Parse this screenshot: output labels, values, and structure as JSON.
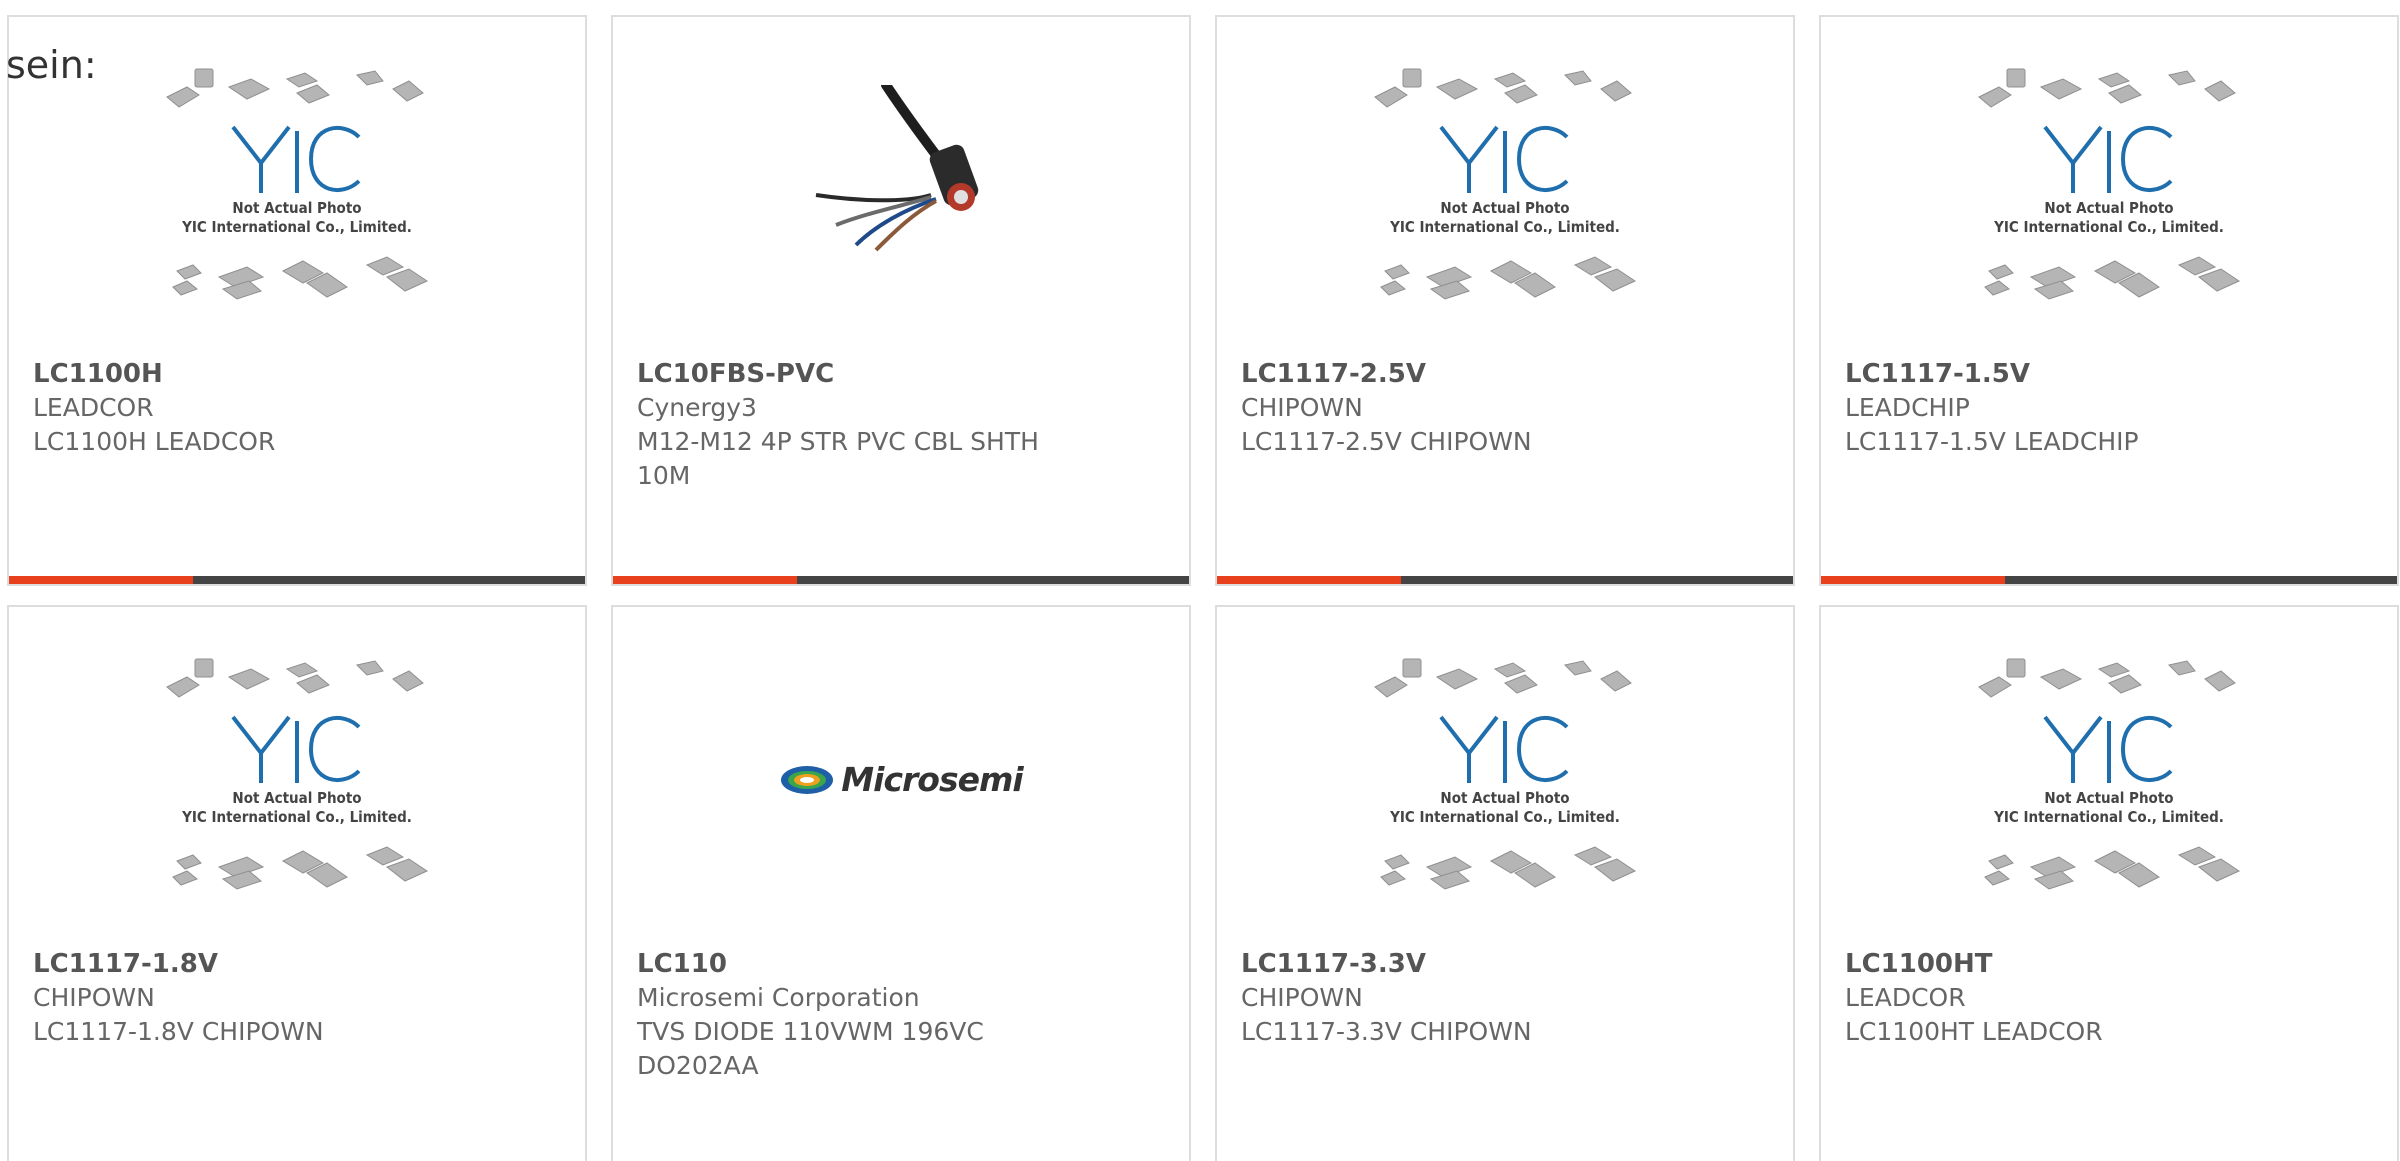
{
  "lead_text": "sein:",
  "placeholder": {
    "line1": "Not Actual Photo",
    "line2": "YIC International Co., Limited."
  },
  "accent_color": "#e8401c",
  "bar_color": "#444444",
  "products": [
    {
      "part": "LC1100H",
      "manufacturer": "LEADCOR",
      "description": "LC1100H LEADCOR",
      "image": "yic-placeholder"
    },
    {
      "part": "LC10FBS-PVC",
      "manufacturer": "Cynergy3",
      "description": "M12-M12 4P STR PVC CBL SHTH 10M",
      "image": "cable-photo"
    },
    {
      "part": "LC1117-2.5V",
      "manufacturer": "CHIPOWN",
      "description": "LC1117-2.5V CHIPOWN",
      "image": "yic-placeholder"
    },
    {
      "part": "LC1117-1.5V",
      "manufacturer": "LEADCHIP",
      "description": "LC1117-1.5V LEADCHIP",
      "image": "yic-placeholder"
    },
    {
      "part": "LC1117-1.8V",
      "manufacturer": "CHIPOWN",
      "description": "LC1117-1.8V CHIPOWN",
      "image": "yic-placeholder"
    },
    {
      "part": "LC110",
      "manufacturer": "Microsemi Corporation",
      "description": "TVS DIODE 110VWM 196VC DO202AA",
      "image": "microsemi-logo"
    },
    {
      "part": "LC1117-3.3V",
      "manufacturer": "CHIPOWN",
      "description": "LC1117-3.3V CHIPOWN",
      "image": "yic-placeholder"
    },
    {
      "part": "LC1100HT",
      "manufacturer": "LEADCOR",
      "description": "LC1100HT LEADCOR",
      "image": "yic-placeholder"
    }
  ],
  "microsemi_logo_text": "Microsemi"
}
